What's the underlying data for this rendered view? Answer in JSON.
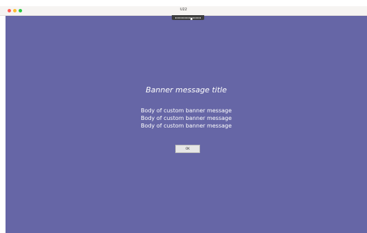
{
  "window": {
    "title": "U22"
  },
  "banner": {
    "title": "Banner message title",
    "body_lines": [
      "Body of custom banner message",
      "Body of custom banner message",
      "Body of custom banner message"
    ],
    "ok_label": "OK"
  },
  "colors": {
    "background": "#6666a6",
    "close": "#fe5f57",
    "minimize": "#febc2e",
    "zoom": "#28c840"
  },
  "icons": {
    "close": "close-dot-icon",
    "minimize": "minimize-dot-icon",
    "zoom": "zoom-dot-icon",
    "toolbar": "vnc-toolbar-handle-icon"
  }
}
